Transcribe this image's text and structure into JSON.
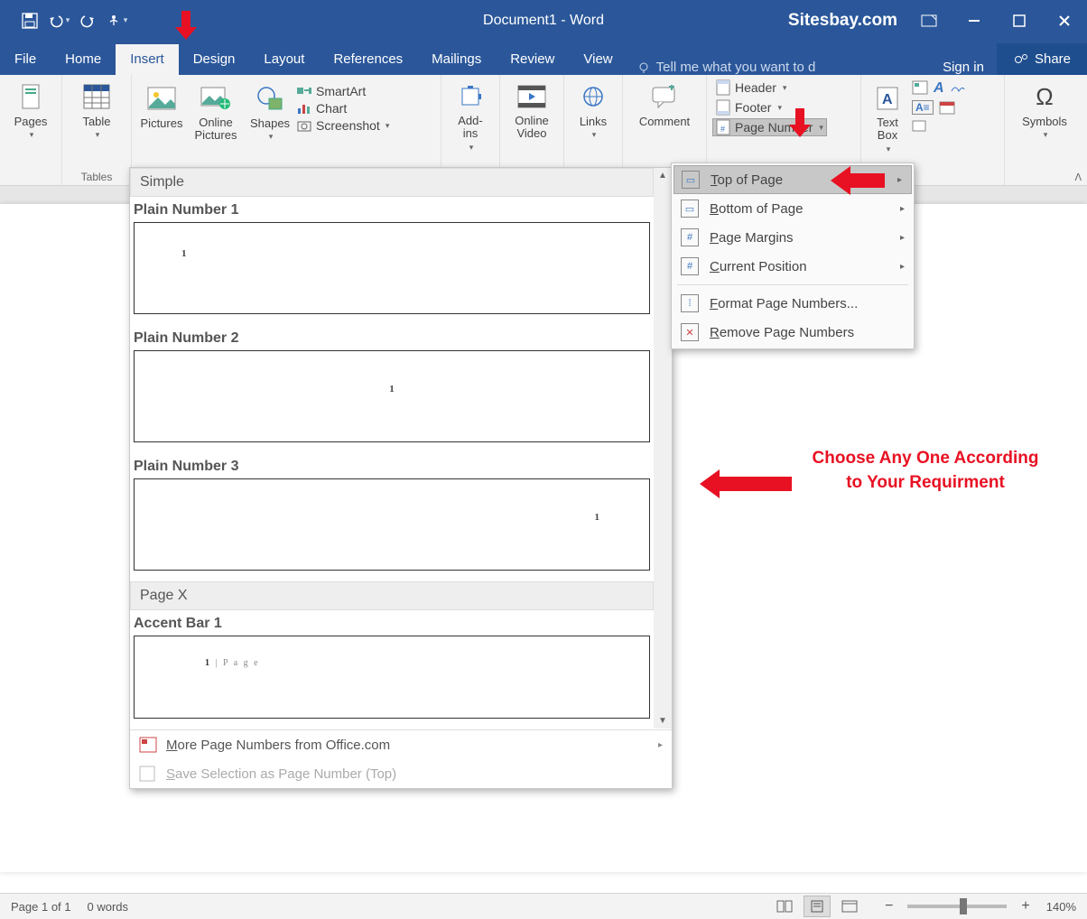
{
  "title": "Document1 - Word",
  "brand": "Sitesbay.com",
  "qat": {
    "save": "Save",
    "undo": "Undo",
    "redo": "Redo",
    "touch": "Touch mode"
  },
  "win": {
    "opts": "Display options",
    "min": "Minimize",
    "max": "Maximize",
    "close": "Close"
  },
  "tabs": [
    "File",
    "Home",
    "Insert",
    "Design",
    "Layout",
    "References",
    "Mailings",
    "Review",
    "View"
  ],
  "tellme": "Tell me what you want to d",
  "signin": "Sign in",
  "share": "Share",
  "ribbon": {
    "pages": "Pages",
    "table": "Table",
    "tables": "Tables",
    "pictures": "Pictures",
    "online_pictures": "Online Pictures",
    "shapes": "Shapes",
    "smartart": "SmartArt",
    "chart": "Chart",
    "screenshot": "Screenshot",
    "addins": "Add-ins",
    "online_video": "Online Video",
    "links": "Links",
    "comment": "Comment",
    "header": "Header",
    "footer": "Footer",
    "page_number": "Page Number",
    "text_box": "Text Box",
    "symbols": "Symbols"
  },
  "page_number_menu": {
    "top": "Top of Page",
    "bottom": "Bottom of Page",
    "margins": "Page Margins",
    "current": "Current Position",
    "format": "Format Page Numbers...",
    "remove": "Remove Page Numbers"
  },
  "gallery": {
    "cat1": "Simple",
    "item1": "Plain Number 1",
    "item2": "Plain Number 2",
    "item3": "Plain Number 3",
    "cat2": "Page X",
    "item4": "Accent Bar 1",
    "accent_text": "1 | P a g e",
    "more": "More Page Numbers from Office.com",
    "save_sel": "Save Selection as Page Number (Top)"
  },
  "callout": "Choose Any One According to Your Requirment",
  "status": {
    "page": "Page 1 of 1",
    "words": "0 words",
    "zoom": "140%"
  }
}
